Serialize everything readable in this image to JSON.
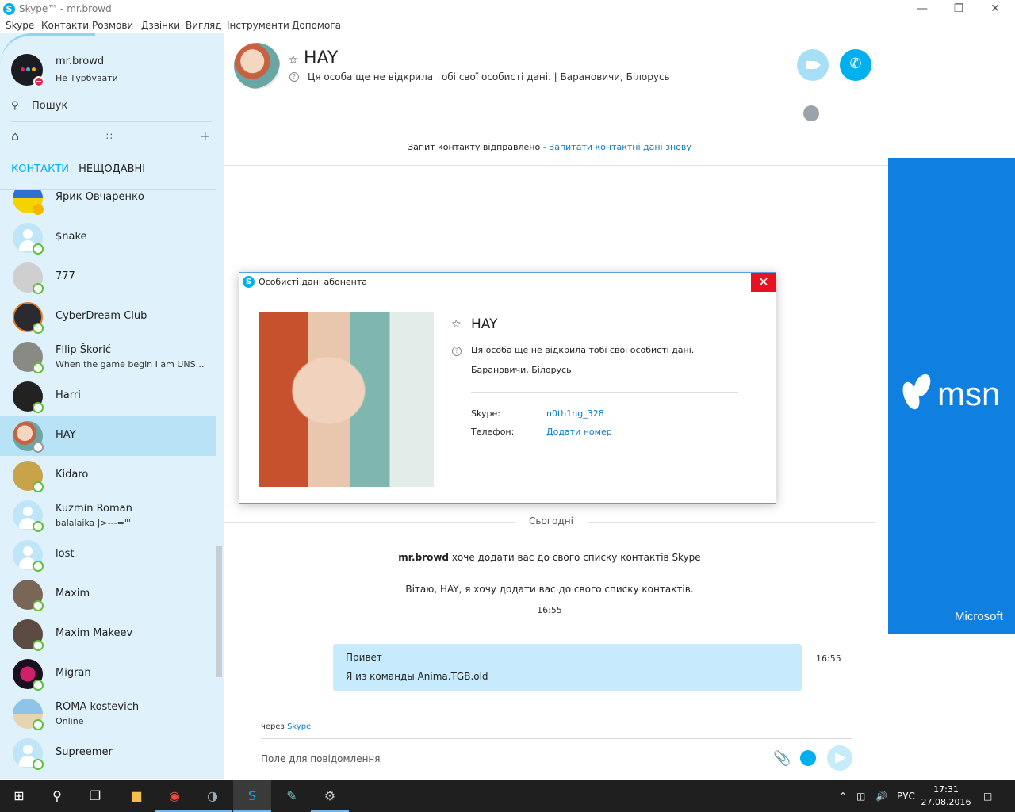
{
  "window": {
    "title": "Skype™ - mr.browd",
    "logo_glyph": "S",
    "minimize": "—",
    "maximize": "❐",
    "close": "✕"
  },
  "menu": [
    "Skype",
    "Контакти",
    "Розмови",
    "Дзвінки",
    "Вигляд",
    "Інструменти",
    "Допомога"
  ],
  "profile": {
    "name": "mr.browd",
    "status": "Не Турбувати"
  },
  "search": {
    "label": "Пошук"
  },
  "tabs": {
    "contacts": "КОНТАКТИ",
    "recent": "НЕЩОДАВНІ"
  },
  "contacts": [
    {
      "name": "Ярик Овчаренко",
      "sub": "",
      "status": "away"
    },
    {
      "name": "$nake",
      "sub": "",
      "status": "online"
    },
    {
      "name": "777",
      "sub": "",
      "status": "online"
    },
    {
      "name": "CyberDream Club",
      "sub": "",
      "status": "online"
    },
    {
      "name": "Fllip Škorić",
      "sub": "When the game begin I am UNST...",
      "status": "online"
    },
    {
      "name": "Harri",
      "sub": "",
      "status": "online"
    },
    {
      "name": "HAY",
      "sub": "",
      "status": "pending",
      "selected": true
    },
    {
      "name": "Kidaro",
      "sub": "",
      "status": "online"
    },
    {
      "name": "Kuzmin Roman",
      "sub": "balalaika |>---=\"'",
      "status": "online"
    },
    {
      "name": "lost",
      "sub": "",
      "status": "online"
    },
    {
      "name": "Maxim",
      "sub": "",
      "status": "online"
    },
    {
      "name": "Maxim Makeev",
      "sub": "",
      "status": "online"
    },
    {
      "name": "Migran",
      "sub": "",
      "status": "online"
    },
    {
      "name": "ROMA kostevich",
      "sub": "Online",
      "status": "online"
    },
    {
      "name": "Supreemer",
      "sub": "",
      "status": "online"
    }
  ],
  "conversation": {
    "name": "HAY",
    "info": "Ця особа ще не відкрила тобі свої особисті дані.  |  Барановичи, Білорусь",
    "request_text": "Запит контакту відправлено - ",
    "request_link": "Запитати контактні дані знову",
    "today": "Сьогодні",
    "sys_user": "mr.browd",
    "sys_text": " хоче додати вас до свого списку контактів Skype",
    "greeting": "Вітаю, HAY, я хочу додати вас до свого списку контактів.",
    "sys_time": "16:55",
    "msg_line1": "Привет",
    "msg_line2": "Я из команды Anima.TGB.old",
    "msg_time": "16:55",
    "via_text": "через ",
    "via_link": "Skype",
    "compose_placeholder": "Поле для повідомлення"
  },
  "dialog": {
    "title": "Особисті дані абонента",
    "close": "✕",
    "name": "HAY",
    "privacy": "Ця особа ще не відкрила тобі свої особисті дані.",
    "location": "Барановичи, Білорусь",
    "skype_label": "Skype:",
    "skype_value": "n0th1ng_328",
    "phone_label": "Телефон:",
    "phone_value": "Додати номер"
  },
  "ad": {
    "brand": "msn",
    "footer": "Microsoft"
  },
  "taskbar": {
    "lang": "РУС",
    "time": "17:31",
    "date": "27.08.2016"
  },
  "colors": {
    "skype_blue": "#00aff0",
    "sidebar_bg": "#dff1fb",
    "selected_bg": "#b8e3f7",
    "msn_blue": "#0f7fe0",
    "close_red": "#e81123"
  }
}
